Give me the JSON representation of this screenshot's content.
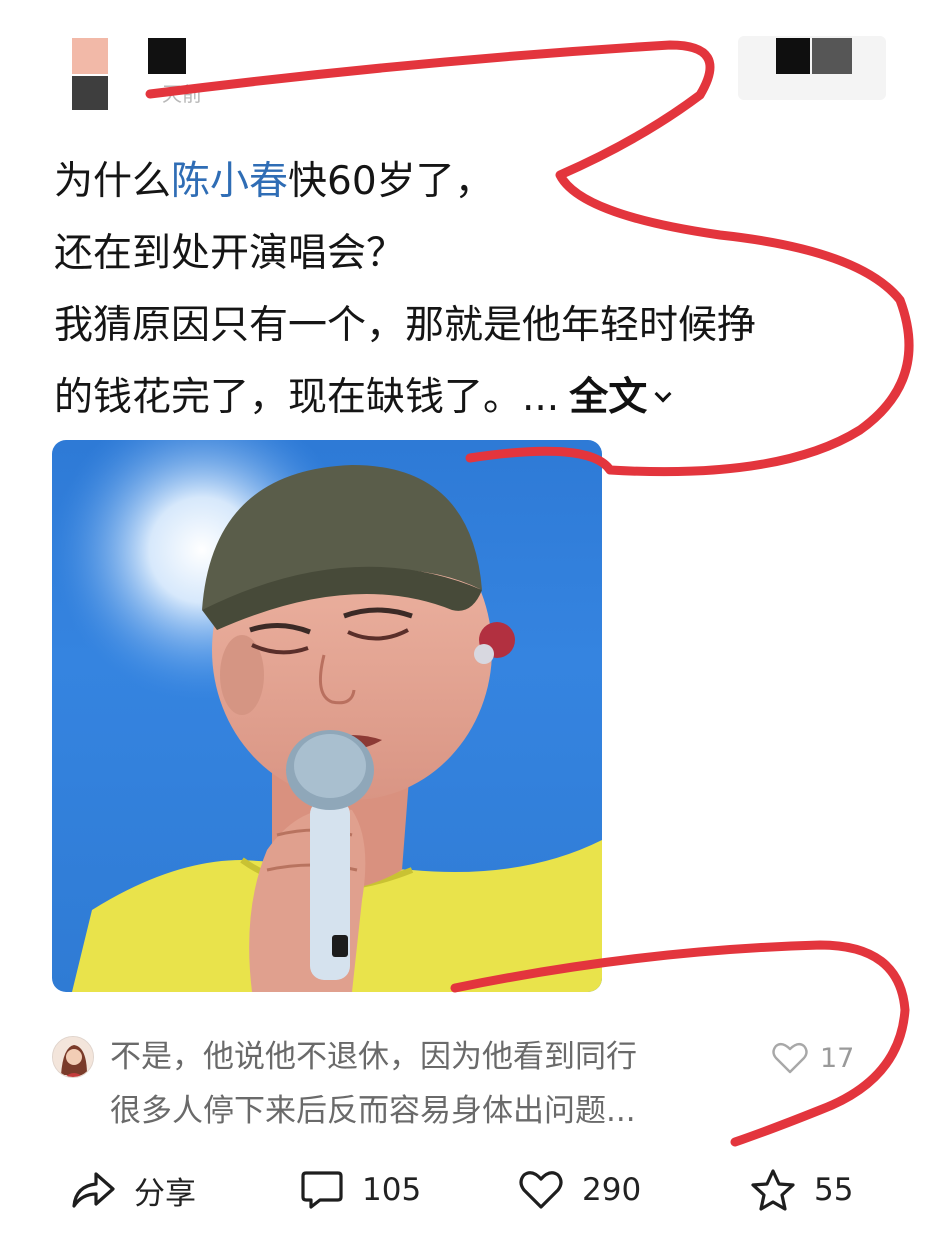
{
  "header": {
    "post_time": "天前"
  },
  "post": {
    "line1_before": "为什么",
    "mention": "陈小春",
    "line1_after": "快60岁了，",
    "line2": "还在到处开演唱会？",
    "line3": "我猜原因只有一个，那就是他年轻时候挣",
    "line4": "的钱花完了，现在缺钱了。...",
    "expand_label": "全文"
  },
  "comment": {
    "line1": "不是，他说他不退休，因为他看到同行",
    "line2": "很多人停下来后反而容易身体出问题...",
    "like_count": "17"
  },
  "actions": {
    "share_label": "分享",
    "comment_count": "105",
    "like_count": "290",
    "favorite_count": "55"
  },
  "colors": {
    "mention": "#2f6db5",
    "annotation": "#e3353d",
    "photo_sky": "#2f7bd4",
    "shirt": "#e8e24a"
  },
  "icons": {
    "comment_like": "heart-outline-icon",
    "share": "share-arrow-icon",
    "comment": "comment-bubble-icon",
    "like": "heart-outline-icon",
    "favorite": "star-outline-icon",
    "expand": "chevron-down-icon"
  }
}
